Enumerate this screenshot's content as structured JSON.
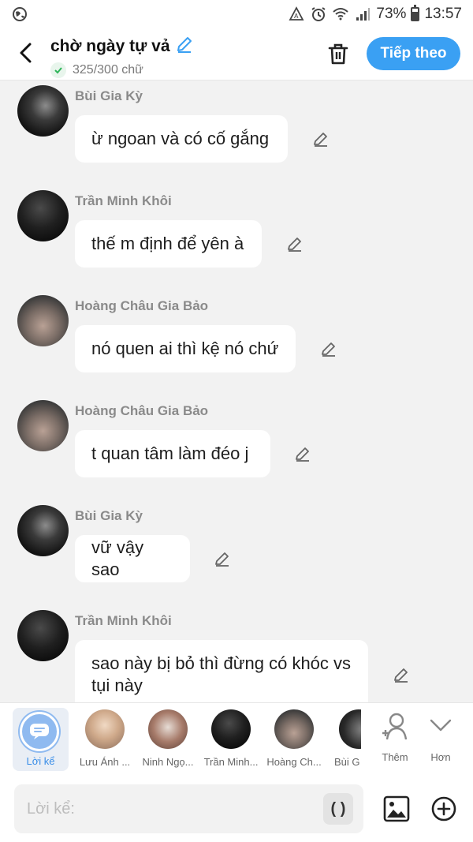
{
  "status_bar": {
    "battery": "73%",
    "time": "13:57",
    "icons": [
      "globe-icon",
      "data-saver-icon",
      "alarm-icon",
      "wifi-icon",
      "signal-icon",
      "battery-icon"
    ]
  },
  "header": {
    "title": "chờ ngày tự vả",
    "char_count": "325/300 chữ",
    "next_label": "Tiếp theo"
  },
  "colors": {
    "accent": "#3aa0f3",
    "bubble": "#ffffff",
    "background": "#f2f2f2"
  },
  "messages": [
    {
      "sender": "Bùi Gia Kỳ",
      "text": "ừ ngoan và có cố gắng"
    },
    {
      "sender": "Trần Minh Khôi",
      "text": "thế m định để yên à"
    },
    {
      "sender": "Hoàng Châu Gia Bảo",
      "text": "nó quen ai thì kệ nó chứ"
    },
    {
      "sender": "Hoàng Châu Gia Bảo",
      "text": "t quan tâm làm đéo j"
    },
    {
      "sender": "Bùi Gia Kỳ",
      "text": "vữ vậy sao"
    },
    {
      "sender": "Trần Minh Khôi",
      "text": "sao này bị bỏ thì đừng có khóc vs tụi này"
    }
  ],
  "characters": {
    "narrator_label": "Lời kể",
    "items": [
      {
        "label": "Lưu Ánh ..."
      },
      {
        "label": "Ninh Ngọ..."
      },
      {
        "label": "Trần Minh..."
      },
      {
        "label": "Hoàng Ch..."
      },
      {
        "label": "Bùi G"
      }
    ],
    "add_label": "Thêm",
    "more_label": "Hơn"
  },
  "input": {
    "placeholder": "Lời kể:",
    "paren_label": "( )"
  }
}
